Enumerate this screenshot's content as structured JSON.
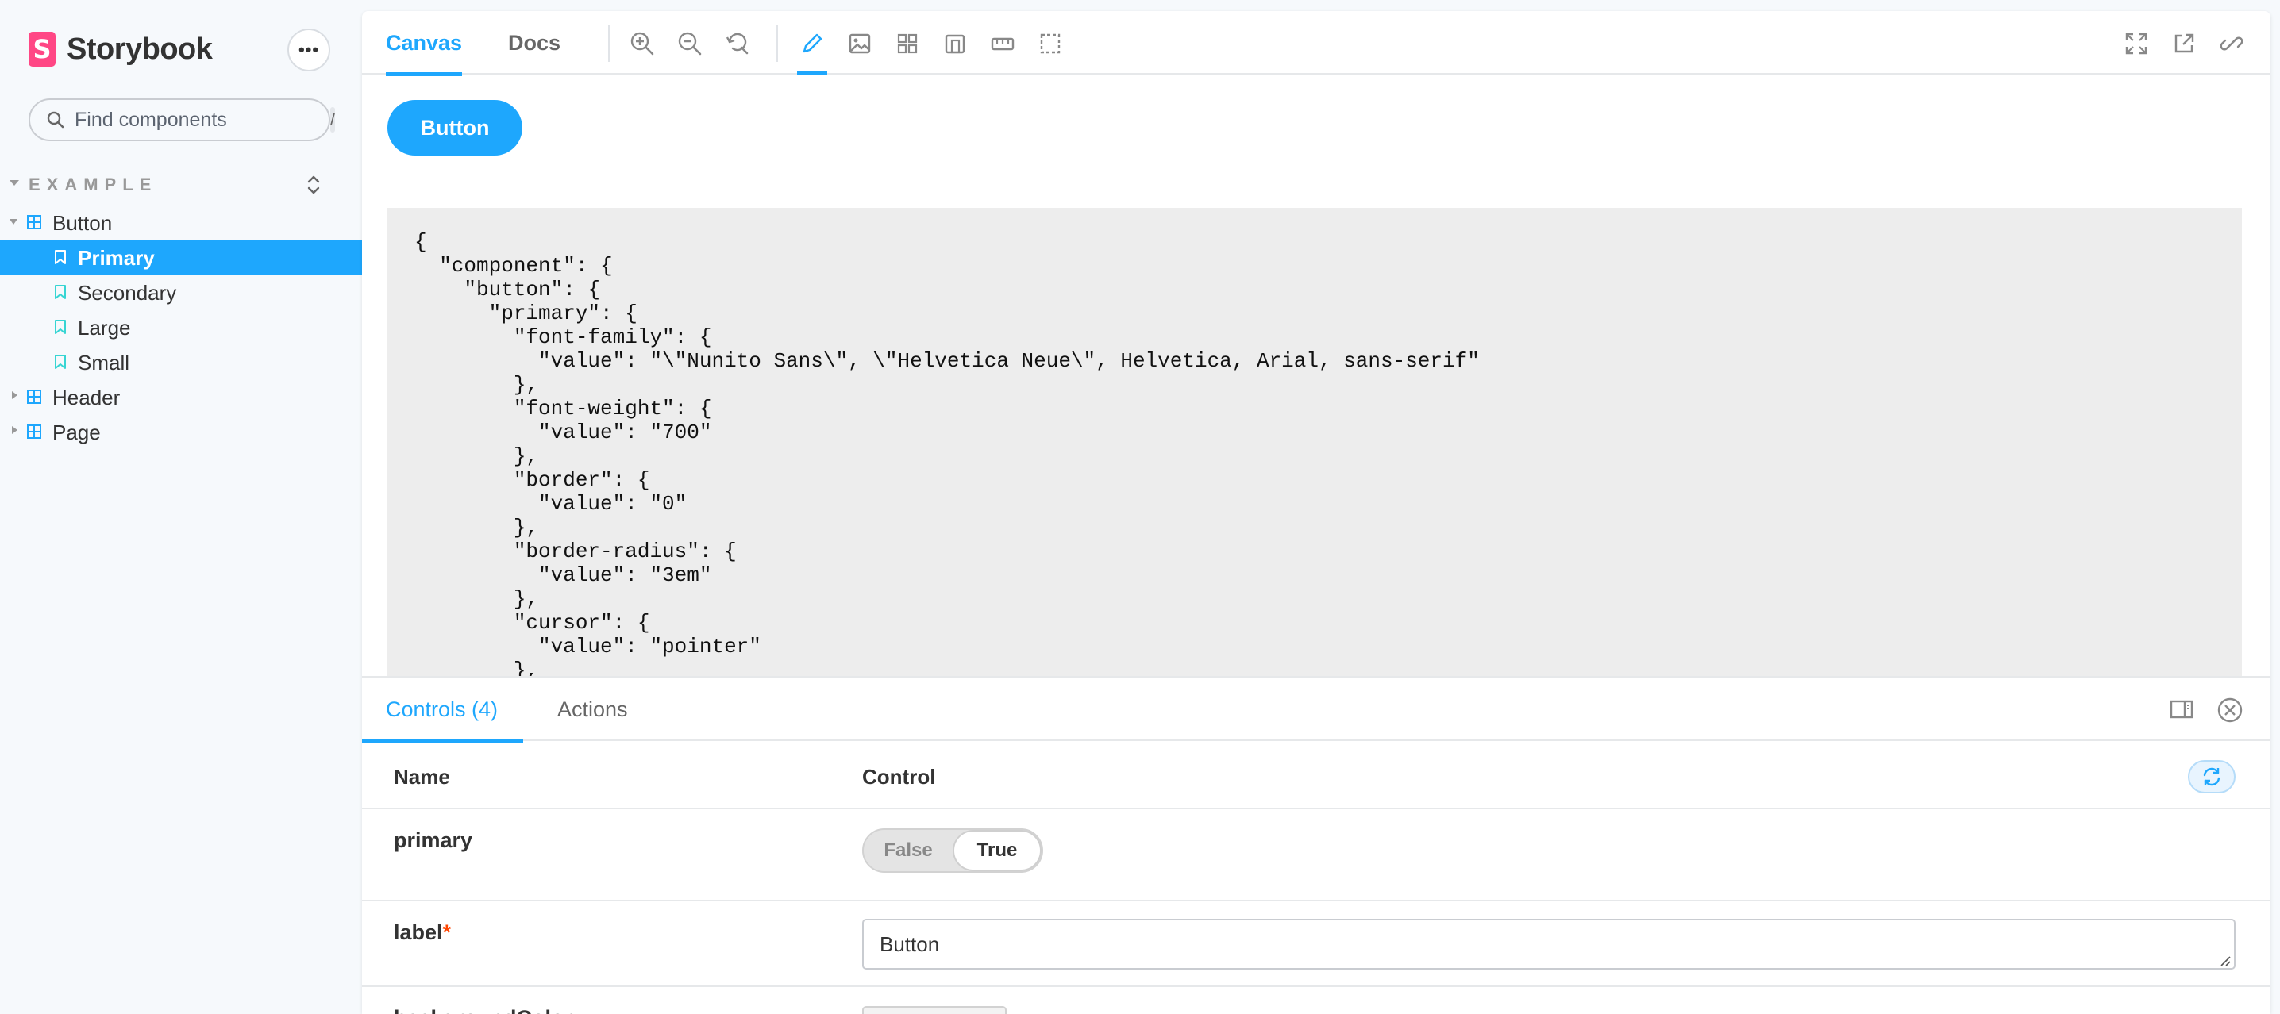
{
  "brand": {
    "name": "Storybook",
    "logo_letter": "S",
    "logo_color": "#ff4785"
  },
  "sidebar": {
    "menu_label": "•••",
    "search": {
      "placeholder": "Find components",
      "shortcut": "/"
    },
    "group": "EXAMPLE",
    "items": [
      {
        "label": "Button",
        "type": "component",
        "expanded": true
      },
      {
        "label": "Primary",
        "type": "story",
        "selected": true
      },
      {
        "label": "Secondary",
        "type": "story"
      },
      {
        "label": "Large",
        "type": "story"
      },
      {
        "label": "Small",
        "type": "story"
      },
      {
        "label": "Header",
        "type": "component",
        "expanded": false
      },
      {
        "label": "Page",
        "type": "component",
        "expanded": false
      }
    ]
  },
  "toolbar": {
    "tabs": [
      "Canvas",
      "Docs"
    ],
    "active_tab": "Canvas",
    "tools": [
      "zoom-in-icon",
      "zoom-out-icon",
      "zoom-reset-icon",
      "design-tokens-icon",
      "background-icon",
      "grid-icon",
      "viewport-icon",
      "measure-icon",
      "outline-icon"
    ],
    "right_tools": [
      "fullscreen-icon",
      "open-new-tab-icon",
      "copy-link-icon"
    ]
  },
  "canvas": {
    "button_label": "Button",
    "code": "{\n  \"component\": {\n    \"button\": {\n      \"primary\": {\n        \"font-family\": {\n          \"value\": \"\\\"Nunito Sans\\\", \\\"Helvetica Neue\\\", Helvetica, Arial, sans-serif\"\n        },\n        \"font-weight\": {\n          \"value\": \"700\"\n        },\n        \"border\": {\n          \"value\": \"0\"\n        },\n        \"border-radius\": {\n          \"value\": \"3em\"\n        },\n        \"cursor\": {\n          \"value\": \"pointer\"\n        },"
  },
  "addons": {
    "tabs": [
      "Controls (4)",
      "Actions"
    ],
    "active_tab": "Controls (4)",
    "columns": {
      "name": "Name",
      "control": "Control"
    },
    "rows": [
      {
        "name": "primary",
        "required": false,
        "control": "boolean",
        "options": [
          "False",
          "True"
        ],
        "value": "True"
      },
      {
        "name": "label",
        "required": true,
        "control": "text",
        "value": "Button"
      },
      {
        "name": "backgroundColor",
        "required": false,
        "control": "color"
      }
    ],
    "required_mark": "*"
  },
  "colors": {
    "accent": "#1ea7fd",
    "required": "#ff4400"
  }
}
